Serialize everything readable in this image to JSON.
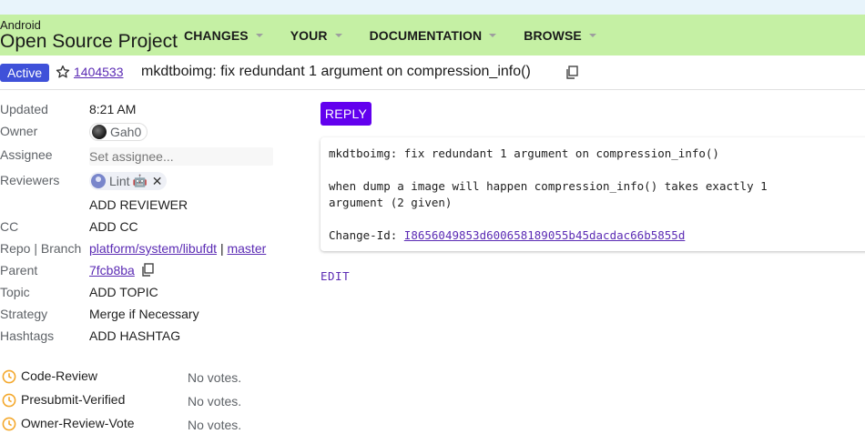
{
  "header": {
    "brand_small": "Android",
    "brand_big": "Open Source Project",
    "nav": [
      "CHANGES",
      "YOUR",
      "DOCUMENTATION",
      "BROWSE"
    ]
  },
  "change": {
    "status": "Active",
    "number": "1404533",
    "subject": "mkdtboimg: fix redundant 1 argument on compression_info()"
  },
  "meta": {
    "updated_label": "Updated",
    "updated_value": "8:21 AM",
    "owner_label": "Owner",
    "owner_name": "Gah0",
    "assignee_label": "Assignee",
    "assignee_placeholder": "Set assignee...",
    "reviewers_label": "Reviewers",
    "reviewer_name": "Lint",
    "reviewer_bot": "🤖",
    "remove_symbol": "✕",
    "add_reviewer": "ADD REVIEWER",
    "cc_label": "CC",
    "add_cc": "ADD CC",
    "repo_label": "Repo | Branch",
    "repo": "platform/system/libufdt",
    "separator": "|",
    "branch": "master",
    "parent_label": "Parent",
    "parent": "7fcb8ba",
    "topic_label": "Topic",
    "add_topic": "ADD TOPIC",
    "strategy_label": "Strategy",
    "strategy": "Merge if Necessary",
    "hashtags_label": "Hashtags",
    "add_hashtag": "ADD HASHTAG"
  },
  "labels": [
    {
      "name": "Code-Review",
      "votes": "No votes."
    },
    {
      "name": "Presubmit-Verified",
      "votes": "No votes."
    },
    {
      "name": "Owner-Review-Vote",
      "votes": "No votes."
    }
  ],
  "commit": {
    "reply": "REPLY",
    "line1": "mkdtboimg: fix redundant 1 argument on compression_info()",
    "line2": "when dump a image will happen compression_info() takes exactly 1",
    "line3": "argument (2 given)",
    "changeid_label": "Change-Id:",
    "changeid": "I8656049853d600658189055b45dacdac66b5855d",
    "edit": "EDIT"
  },
  "colors": {
    "header_bg": "#c5f0a4",
    "accent": "#6200ee",
    "link": "#5b2bb4",
    "status_badge": "#3f51d9",
    "vote_clock": "#f4a82c"
  },
  "icons": [
    "star-icon",
    "copy-icon",
    "clock-icon",
    "close-icon",
    "robot-icon",
    "caret-down-icon"
  ]
}
